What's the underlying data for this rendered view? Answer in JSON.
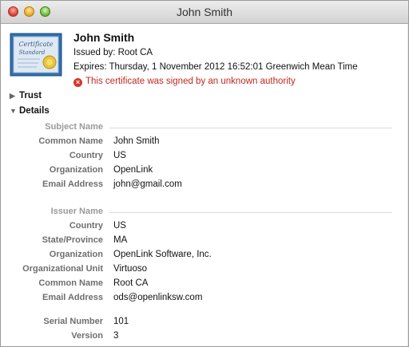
{
  "window": {
    "title": "John Smith"
  },
  "certificate": {
    "name": "John Smith",
    "issued_by": "Issued by: Root CA",
    "expires": "Expires: Thursday, 1 November 2012 16:52:01 Greenwich Mean Time",
    "warning": "This certificate was signed by an unknown authority",
    "icon_text_1": "Certificate",
    "icon_text_2": "Standard"
  },
  "disclosures": {
    "trust": "Trust",
    "details": "Details"
  },
  "subject": {
    "heading": "Subject Name",
    "rows": [
      {
        "label": "Common Name",
        "value": "John Smith"
      },
      {
        "label": "Country",
        "value": "US"
      },
      {
        "label": "Organization",
        "value": "OpenLink"
      },
      {
        "label": "Email Address",
        "value": "john@gmail.com"
      }
    ]
  },
  "issuer": {
    "heading": "Issuer Name",
    "rows": [
      {
        "label": "Country",
        "value": "US"
      },
      {
        "label": "State/Province",
        "value": "MA"
      },
      {
        "label": "Organization",
        "value": "OpenLink Software, Inc."
      },
      {
        "label": "Organizational Unit",
        "value": "Virtuoso"
      },
      {
        "label": "Common Name",
        "value": "Root CA"
      },
      {
        "label": "Email Address",
        "value": "ods@openlinksw.com"
      }
    ]
  },
  "extra": {
    "rows": [
      {
        "label": "Serial Number",
        "value": "101"
      },
      {
        "label": "Version",
        "value": "3"
      }
    ]
  }
}
